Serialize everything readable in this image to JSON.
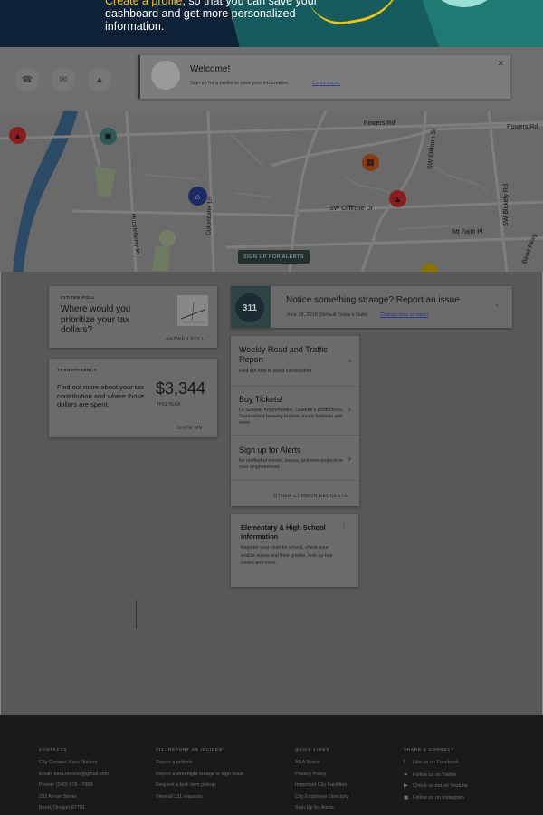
{
  "hero": {
    "line1_highlight": "Create a profile",
    "line1_rest": ", so that you can save your",
    "line2": "dashboard and get more personalized",
    "line3": "information."
  },
  "quick_actions": [
    {
      "name": "phone-icon",
      "glyph": "☎"
    },
    {
      "name": "mail-icon",
      "glyph": "✉"
    },
    {
      "name": "warning-icon",
      "glyph": "▲"
    }
  ],
  "welcome": {
    "title": "Welcome!",
    "subtitle": "Sign up for a profile to save your information.",
    "link": "Count me in."
  },
  "map": {
    "streets": {
      "powers_rd_1": "Powers Rd",
      "powers_rd_2": "Powers Rd",
      "sw_elkhorn": "SW Elkhorn St",
      "sw_cliffrose": "SW Cliffrose Dr",
      "sw_blakely": "SW Blakely Rd",
      "mt_faith": "Mt Faith Pl",
      "huckleberry": "Huckleberry Pl",
      "columbine": "Columbine Ln",
      "bend_pkwy": "Bend Pkwy"
    },
    "signup_button": "SIGN UP FOR ALERTS",
    "pin_colors": {
      "warning": "#8a1d1d",
      "business": "#2d5a58",
      "home": "#1e2a66",
      "building": "#8a3a10",
      "pending": "#8a7400"
    }
  },
  "poll": {
    "eyebrow": "CITIZEN POLL",
    "question": "Where would you prioritize your tax dollars?",
    "action": "ANSWER POLL"
  },
  "transparency": {
    "eyebrow": "TRANSPARENCY",
    "description": "Find out more about your tax contribution and where those dollars are spent.",
    "amount": "$3,344",
    "period": "THIS YEAR",
    "action": "SHOW ME"
  },
  "report": {
    "badge": "311",
    "title": "Notice something strange? Report an issue",
    "date": "June 25, 2018 (Default Today's Date)",
    "change_link": "Change date of report"
  },
  "requests": {
    "items": [
      {
        "title": "Weekly Road and Traffic Report",
        "desc": "Find out how to avoid construction."
      },
      {
        "title": "Buy Tickets!",
        "desc": "Le Schwab Amphitheatre, Children's productions, Summerfest brewing festival, music festivals and more."
      },
      {
        "title": "Sign up for Alerts",
        "desc": "Be notified of events, issues, and new projects in your neighborhood."
      }
    ],
    "action": "OTHER COMMON REQUESTS"
  },
  "school": {
    "title": "Elementary & High School Information",
    "desc": "Register your child for school, check your waitlist status and their grades, look up bus routes and more."
  },
  "footer": {
    "contacts": {
      "heading": "CONTACTS",
      "rows": [
        "City Contact: Kara Nielson",
        "Email: kara.nielson@gmail.com",
        "Phone: (540) 678 - 7899",
        "232 Arnon Street",
        "Bend, Oregon 97701"
      ]
    },
    "report": {
      "heading": "311: REPORT AN INCIDENT",
      "rows": [
        "Report a pothole",
        "Report a streetlight outage or sign issue",
        "Request a bulk item pickup",
        "View all 311 requests"
      ]
    },
    "quick_links": {
      "heading": "QUICK LINKS",
      "rows": [
        "ADA Notice",
        "Privacy Policy",
        "Important City Facilities",
        "City Employee Directory",
        "Sign Up for Alerts"
      ]
    },
    "share": {
      "heading": "SHARE & CONNECT",
      "rows": [
        {
          "icon": "facebook-icon",
          "glyph": "f",
          "label": "Like us on Facebook"
        },
        {
          "icon": "twitter-icon",
          "glyph": "❧",
          "label": "Follow us on Twitter"
        },
        {
          "icon": "youtube-icon",
          "glyph": "▶",
          "label": "Check us out on Youtube"
        },
        {
          "icon": "instagram-icon",
          "glyph": "▣",
          "label": "Follow us on Instagram"
        }
      ]
    }
  }
}
